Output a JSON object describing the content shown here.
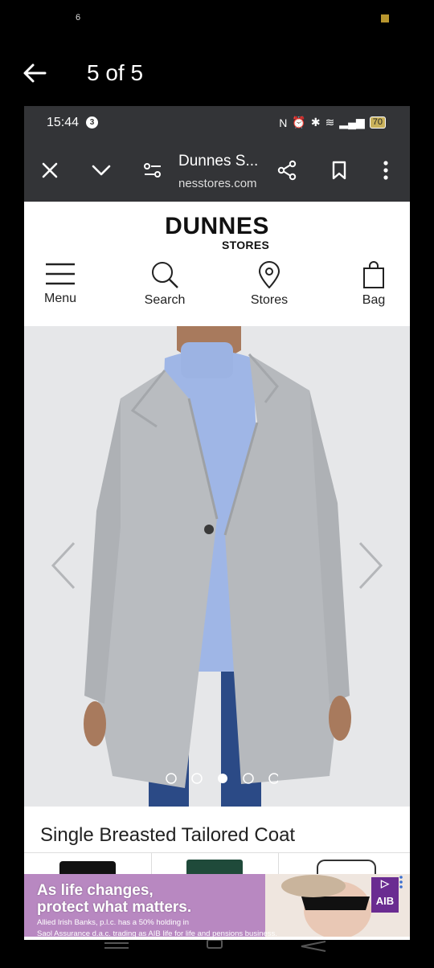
{
  "outer": {
    "status_number": "6",
    "counter": "5 of 5"
  },
  "phone_status": {
    "time": "15:44",
    "notification_count": "3",
    "battery": "70"
  },
  "browser": {
    "title": "Dunnes S...",
    "url": "nesstores.com"
  },
  "site": {
    "logo_main": "DUNNES",
    "logo_sub": "STORES",
    "nav": [
      {
        "label": "Menu",
        "icon": "hamburger-icon"
      },
      {
        "label": "Search",
        "icon": "search-icon"
      },
      {
        "label": "Stores",
        "icon": "location-pin-icon"
      },
      {
        "label": "Bag",
        "icon": "bag-icon"
      }
    ],
    "carousel": {
      "dots": 5,
      "active_dot": 3
    },
    "product_title": "Single Breasted Tailored Coat"
  },
  "ad": {
    "headline_1": "As life changes,",
    "headline_2": "protect what matters.",
    "small_1": "Allied Irish Banks, p.l.c. has a 50% holding in",
    "small_2": "Saol Assurance d.a.c. trading as AIB life for life and pensions business.",
    "brand": "AIB"
  },
  "colors": {
    "aib_purple": "#6a2c91",
    "coat_grey": "#b9bcc0",
    "sweater_blue": "#9fb6e6"
  }
}
